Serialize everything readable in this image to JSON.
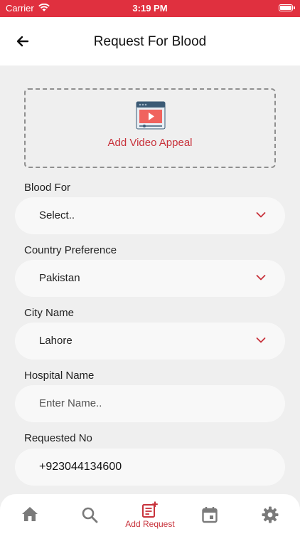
{
  "status_bar": {
    "carrier": "Carrier",
    "time": "3:19 PM"
  },
  "header": {
    "title": "Request For Blood"
  },
  "video_appeal": {
    "label": "Add Video Appeal"
  },
  "form": {
    "blood_for": {
      "label": "Blood For",
      "value": "Select.."
    },
    "country": {
      "label": "Country Preference",
      "value": "Pakistan"
    },
    "city": {
      "label": "City Name",
      "value": "Lahore"
    },
    "hospital": {
      "label": "Hospital Name",
      "placeholder": "Enter Name.."
    },
    "requested_no": {
      "label": "Requested No",
      "value": "+923044134600"
    }
  },
  "tabs": [
    {
      "icon": "home-icon"
    },
    {
      "icon": "search-icon"
    },
    {
      "icon": "add-request-icon",
      "label": "Add Request",
      "active": true
    },
    {
      "icon": "calendar-icon"
    },
    {
      "icon": "gear-icon"
    }
  ],
  "colors": {
    "accent": "#e0303f",
    "accent_text": "#c8323b",
    "background": "#efefef",
    "icons": "#7a7a7a"
  }
}
